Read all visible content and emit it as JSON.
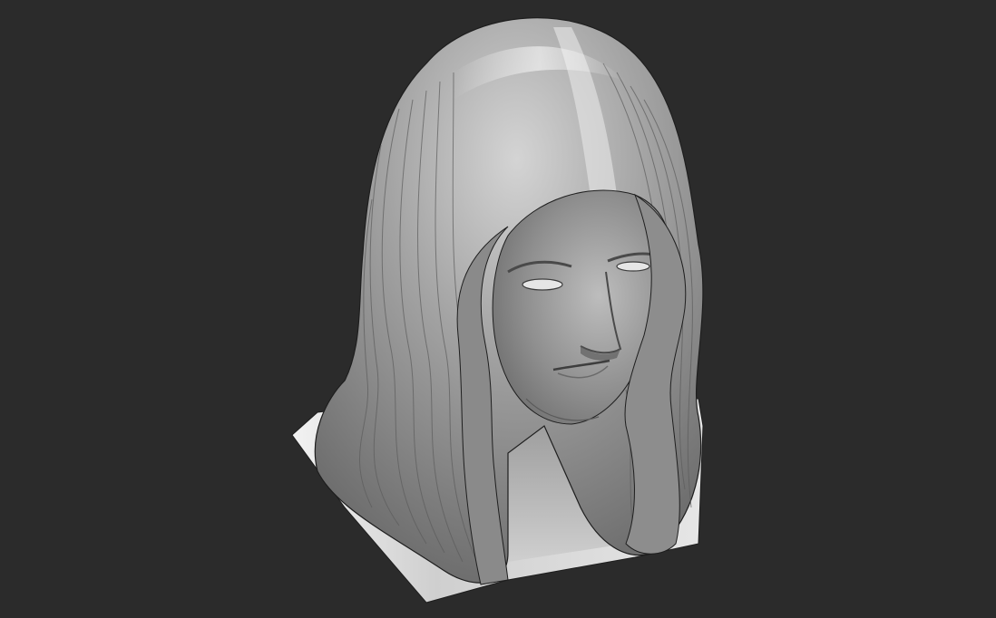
{
  "scene": {
    "subject": "sculpted-bust",
    "colors": {
      "background": "#2b2b2b",
      "clay_light": "#e2e2e2",
      "clay_mid": "#a9a9a9",
      "clay_dark": "#6a6a6a",
      "outline": "#1e1e1e"
    }
  }
}
